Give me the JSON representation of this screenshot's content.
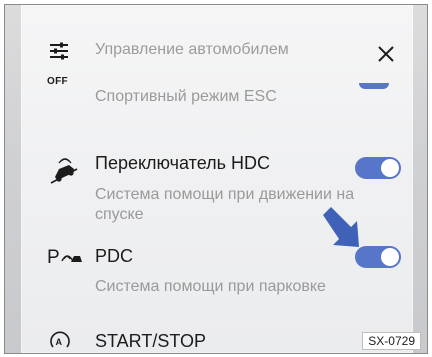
{
  "header": {
    "title": "Управление автомобилем",
    "close_icon": "close-icon",
    "menu_icon": "sliders-icon",
    "off_label": "OFF"
  },
  "esc_row": {
    "subtitle": "Спортивный режим ESC"
  },
  "hdc_row": {
    "icon": "hdc-descent-car-icon",
    "title": "Переключатель HDC",
    "subtitle": "Система помощи при движении на спуске",
    "enabled": true
  },
  "pdc_row": {
    "icon": "parking-assist-icon",
    "title": "PDC",
    "subtitle": "Система помощи при парковке",
    "enabled": true,
    "indicator": "arrow-pointer-icon"
  },
  "startstop_row": {
    "icon": "auto-start-stop-icon",
    "title": "START/STOP"
  },
  "figure_code": "SX-0729",
  "colors": {
    "toggle_on": "#5876c9",
    "arrow": "#3f62b8",
    "primary_text": "#1c1c1c",
    "secondary_text": "#9a9a9a"
  }
}
